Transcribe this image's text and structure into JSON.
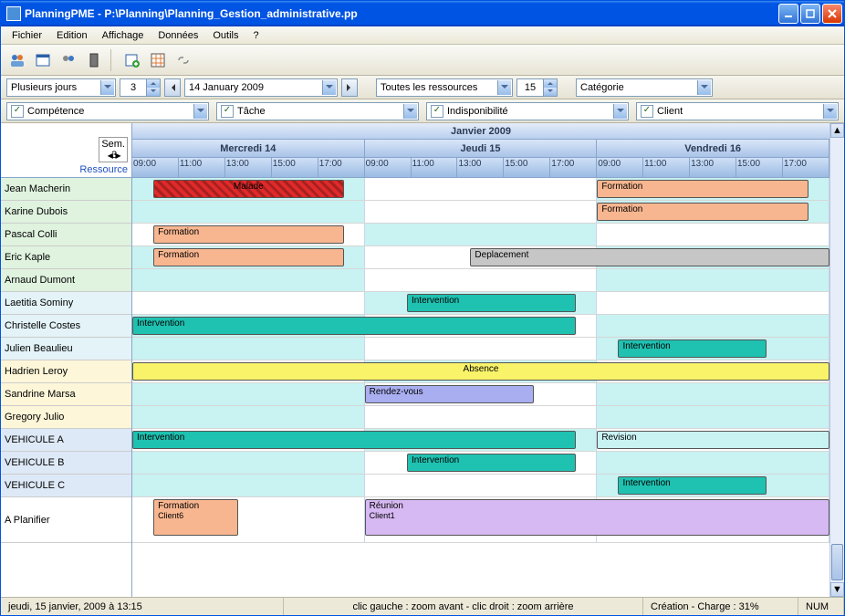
{
  "window": {
    "title": "PlanningPME - P:\\Planning\\Planning_Gestion_administrative.pp"
  },
  "menu": {
    "items": [
      "Fichier",
      "Edition",
      "Affichage",
      "Données",
      "Outils",
      "?"
    ]
  },
  "controlbar": {
    "view_mode": "Plusieurs jours",
    "days": "3",
    "date": "14   January   2009",
    "resource_filter": "Toutes les ressources",
    "resource_count": "15",
    "category": "Catégorie"
  },
  "filterbar": {
    "competence": "Compétence",
    "tache": "Tâche",
    "indispo": "Indisponibilité",
    "client": "Client"
  },
  "header": {
    "month": "Janvier 2009",
    "week_label": "Sem.",
    "week_num": "3",
    "resource_label": "Ressource",
    "days": [
      "Mercredi 14",
      "Jeudi 15",
      "Vendredi 16"
    ],
    "hours": [
      "09:00",
      "11:00",
      "13:00",
      "15:00",
      "17:00"
    ]
  },
  "resources": [
    {
      "name": "Jean Macherin",
      "bg": "#dff3df"
    },
    {
      "name": "Karine Dubois",
      "bg": "#dff3df"
    },
    {
      "name": "Pascal Colli",
      "bg": "#dff3df"
    },
    {
      "name": "Eric Kaple",
      "bg": "#dff3df"
    },
    {
      "name": "Arnaud Dumont",
      "bg": "#dff3df"
    },
    {
      "name": "Laetitia Sominy",
      "bg": "#e3f3f7"
    },
    {
      "name": "Christelle Costes",
      "bg": "#e3f3f7"
    },
    {
      "name": "Julien Beaulieu",
      "bg": "#e3f3f7"
    },
    {
      "name": "Hadrien Leroy",
      "bg": "#fdf6d8"
    },
    {
      "name": "Sandrine Marsa",
      "bg": "#fdf6d8"
    },
    {
      "name": "Gregory Julio",
      "bg": "#fdf6d8"
    },
    {
      "name": "VEHICULE A",
      "bg": "#dee9f7"
    },
    {
      "name": "VEHICULE B",
      "bg": "#dee9f7"
    },
    {
      "name": "VEHICULE C",
      "bg": "#dee9f7"
    },
    {
      "name": "A Planifier",
      "bg": "#ffffff",
      "tall": true
    }
  ],
  "row_bg": [
    [
      "#c9f2f2",
      "#ffffff",
      "#c9f2f2"
    ],
    [
      "#c9f2f2",
      "#ffffff",
      "#c9f2f2"
    ],
    [
      "#ffffff",
      "#c9f2f2",
      "#ffffff"
    ],
    [
      "#c9f2f2",
      "#ffffff",
      "#c9f2f2"
    ],
    [
      "#c9f2f2",
      "#ffffff",
      "#c9f2f2"
    ],
    [
      "#ffffff",
      "#c9f2f2",
      "#ffffff"
    ],
    [
      "#c9f2f2",
      "#ffffff",
      "#c9f2f2"
    ],
    [
      "#c9f2f2",
      "#ffffff",
      "#c9f2f2"
    ],
    [
      "#ffffff",
      "#c9f2f2",
      "#ffffff"
    ],
    [
      "#c9f2f2",
      "#ffffff",
      "#c9f2f2"
    ],
    [
      "#c9f2f2",
      "#ffffff",
      "#c9f2f2"
    ],
    [
      "#ffffff",
      "#c9f2f2",
      "#ffffff"
    ],
    [
      "#c9f2f2",
      "#ffffff",
      "#c9f2f2"
    ],
    [
      "#c9f2f2",
      "#ffffff",
      "#c9f2f2"
    ],
    [
      "#ffffff",
      "#ffffff",
      "#ffffff"
    ]
  ],
  "tasks": [
    {
      "row": 0,
      "label": "Malade",
      "d0": 0,
      "h0": 9,
      "d1": 0,
      "h1": 18,
      "bg": "#e02a2a",
      "fg": "#000",
      "hatch": true,
      "center": true
    },
    {
      "row": 0,
      "label": "Formation",
      "d0": 2,
      "h0": 8,
      "d1": 2,
      "h1": 18,
      "bg": "#f8b690",
      "fg": "#000"
    },
    {
      "row": 1,
      "label": "Formation",
      "d0": 2,
      "h0": 8,
      "d1": 2,
      "h1": 18,
      "bg": "#f8b690",
      "fg": "#000"
    },
    {
      "row": 2,
      "label": "Formation",
      "d0": 0,
      "h0": 9,
      "d1": 0,
      "h1": 18,
      "bg": "#f8b690",
      "fg": "#000"
    },
    {
      "row": 3,
      "label": "Formation",
      "d0": 0,
      "h0": 9,
      "d1": 0,
      "h1": 18,
      "bg": "#f8b690",
      "fg": "#000"
    },
    {
      "row": 3,
      "label": "Deplacement",
      "d0": 1,
      "h0": 13,
      "d1": 2,
      "h1": 19,
      "bg": "#c6c6c6",
      "fg": "#000"
    },
    {
      "row": 5,
      "label": "Intervention",
      "d0": 1,
      "h0": 10,
      "d1": 1,
      "h1": 18,
      "bg": "#1fc1b1",
      "fg": "#000"
    },
    {
      "row": 6,
      "label": "Intervention",
      "d0": 0,
      "h0": 8,
      "d1": 1,
      "h1": 18,
      "bg": "#1fc1b1",
      "fg": "#000"
    },
    {
      "row": 7,
      "label": "Intervention",
      "d0": 2,
      "h0": 9,
      "d1": 2,
      "h1": 16,
      "bg": "#1fc1b1",
      "fg": "#000"
    },
    {
      "row": 8,
      "label": "Absence",
      "d0": 0,
      "h0": 8,
      "d1": 2,
      "h1": 19,
      "bg": "#f9f36a",
      "fg": "#000",
      "center": true
    },
    {
      "row": 9,
      "label": "Rendez-vous",
      "d0": 1,
      "h0": 8,
      "d1": 1,
      "h1": 16,
      "bg": "#a8aef0",
      "fg": "#000"
    },
    {
      "row": 11,
      "label": "Intervention",
      "d0": 0,
      "h0": 8,
      "d1": 1,
      "h1": 18,
      "bg": "#1fc1b1",
      "fg": "#000"
    },
    {
      "row": 11,
      "label": "Revision",
      "d0": 2,
      "h0": 8,
      "d1": 2,
      "h1": 19,
      "bg": "#c9f2f2",
      "fg": "#000"
    },
    {
      "row": 12,
      "label": "Intervention",
      "d0": 1,
      "h0": 10,
      "d1": 1,
      "h1": 18,
      "bg": "#1fc1b1",
      "fg": "#000"
    },
    {
      "row": 13,
      "label": "Intervention",
      "d0": 2,
      "h0": 9,
      "d1": 2,
      "h1": 16,
      "bg": "#1fc1b1",
      "fg": "#000"
    },
    {
      "row": 14,
      "label": "Formation",
      "sub": "Client6",
      "d0": 0,
      "h0": 9,
      "d1": 0,
      "h1": 13,
      "bg": "#f8b690",
      "fg": "#000",
      "tall": true
    },
    {
      "row": 14,
      "label": "Réunion",
      "sub": "Client1",
      "d0": 1,
      "h0": 8,
      "d1": 2,
      "h1": 19,
      "bg": "#d6b8f2",
      "fg": "#000",
      "tall": true
    }
  ],
  "statusbar": {
    "datetime": "jeudi, 15 janvier, 2009 à 13:15",
    "zoom_hint": "clic gauche : zoom avant - clic droit : zoom arrière",
    "charge": "Création - Charge : 31%",
    "num": "NUM"
  },
  "colors": {
    "day_width_pct": 33.333
  }
}
